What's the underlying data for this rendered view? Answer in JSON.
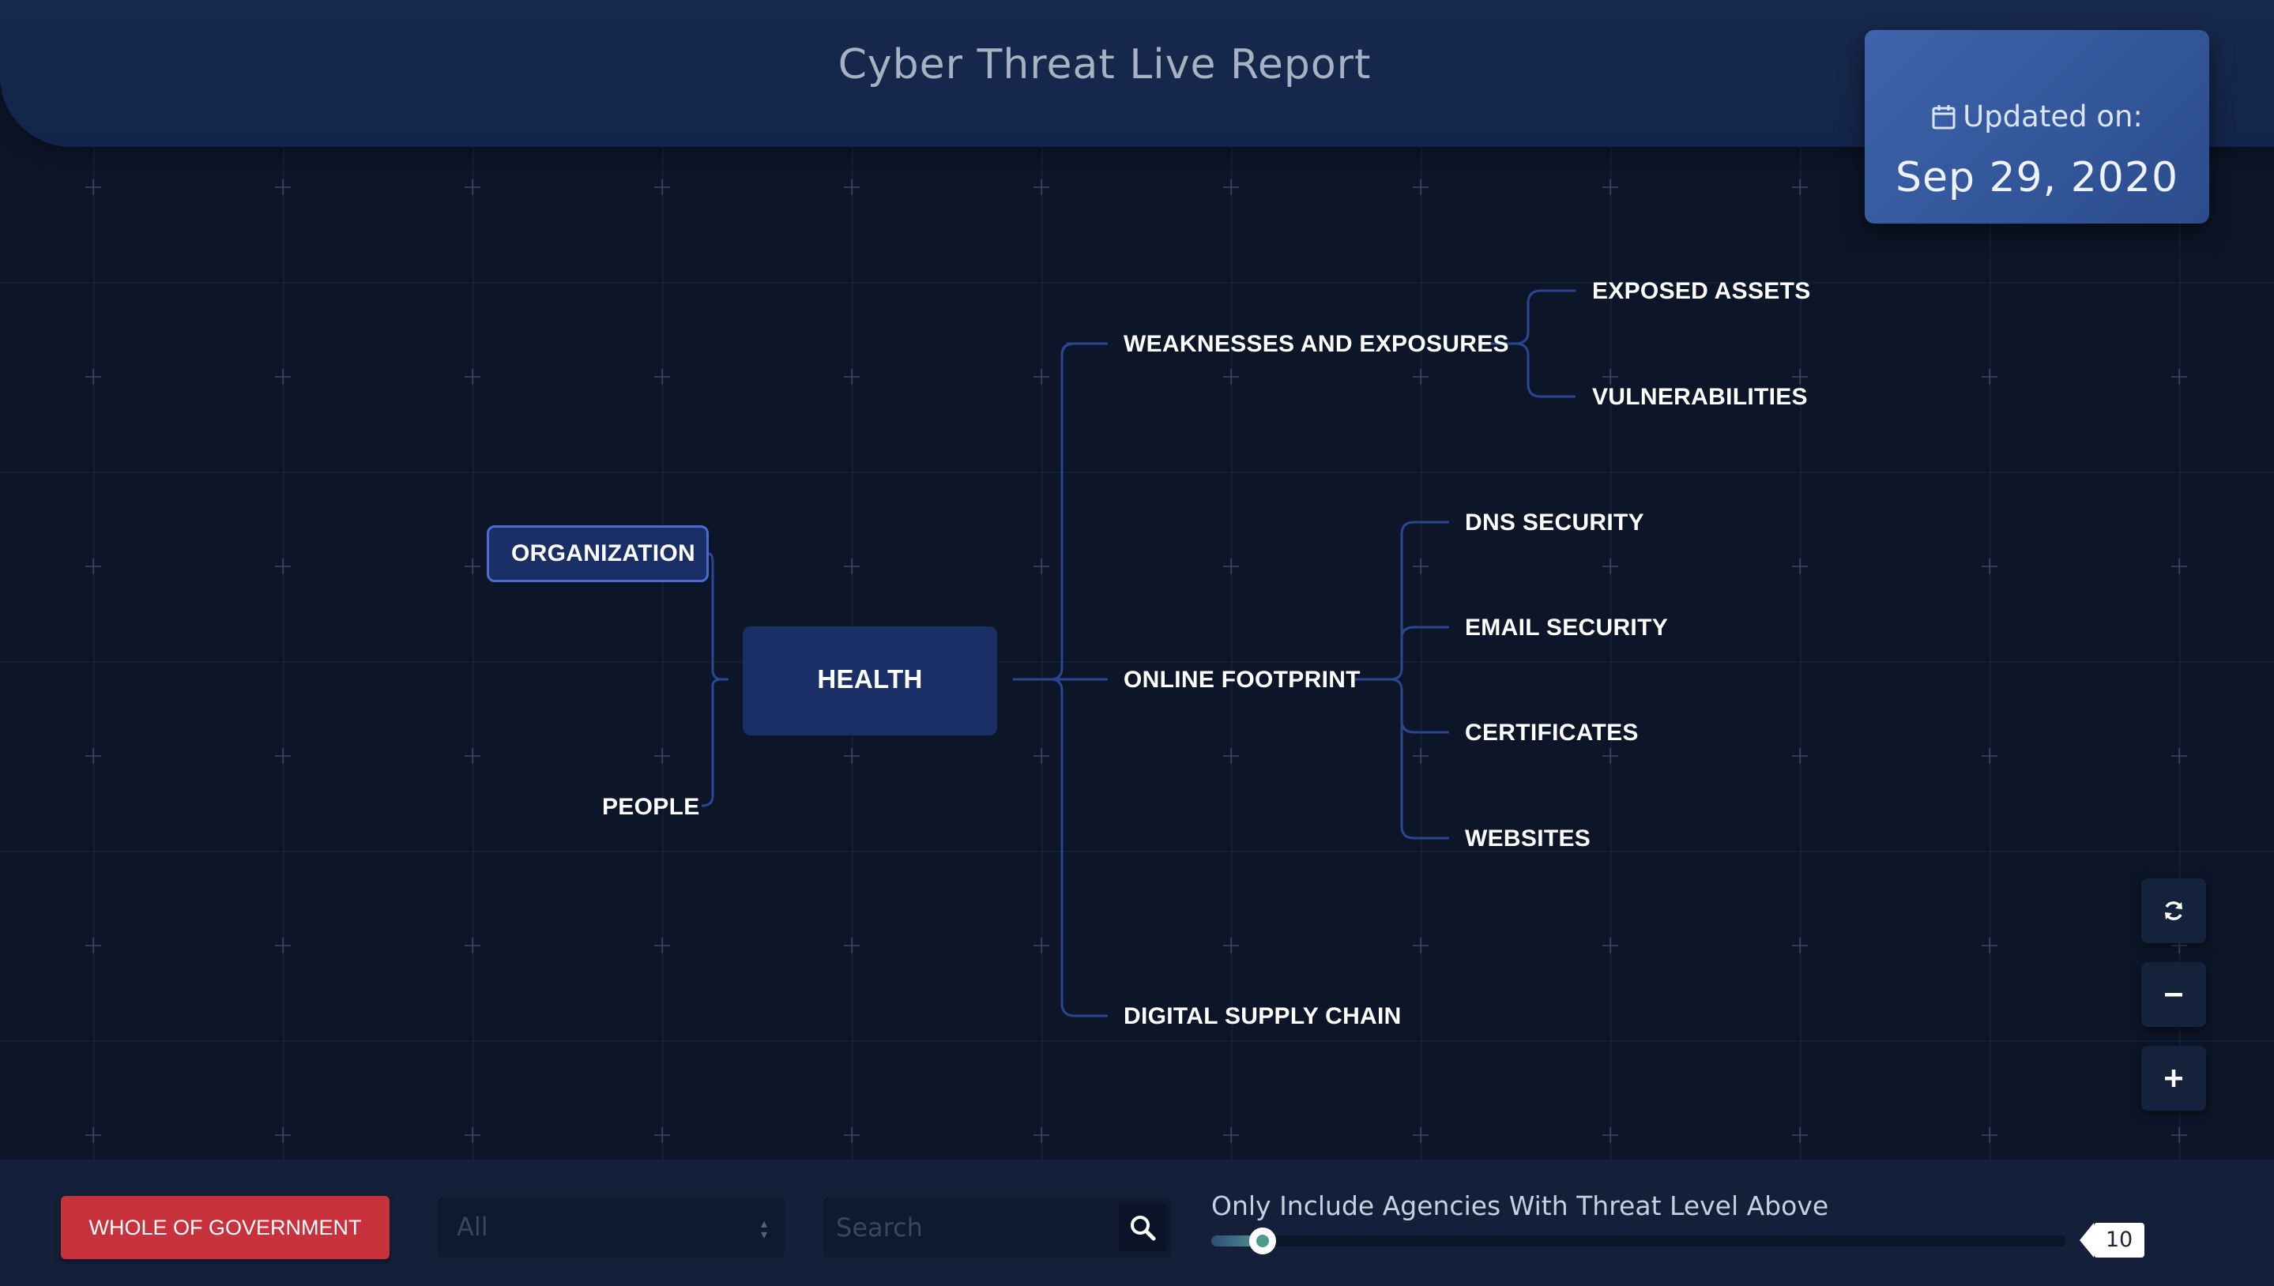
{
  "header": {
    "title": "Cyber Threat Live Report",
    "updated_label": "Updated on:",
    "updated_date": "Sep 29, 2020"
  },
  "tree": {
    "root": "HEALTH",
    "left": [
      "ORGANIZATION",
      "PEOPLE"
    ],
    "right": [
      {
        "label": "WEAKNESSES AND EXPOSURES",
        "children": [
          "EXPOSED ASSETS",
          "VULNERABILITIES"
        ]
      },
      {
        "label": "ONLINE FOOTPRINT",
        "children": [
          "DNS SECURITY",
          "EMAIL SECURITY",
          "CERTIFICATES",
          "WEBSITES"
        ]
      },
      {
        "label": "DIGITAL SUPPLY CHAIN",
        "children": []
      }
    ]
  },
  "controls": {
    "refresh_icon": "refresh-icon",
    "zoom_out_icon": "minus-icon",
    "zoom_in_icon": "plus-icon"
  },
  "footer": {
    "scope_button": "WHOLE OF GOVERNMENT",
    "filter_select": {
      "value": "All"
    },
    "search": {
      "placeholder": "Search",
      "icon": "search-icon"
    },
    "threshold_label": "Only Include Agencies With Threat Level Above",
    "threshold_value": "10",
    "threshold_fraction": 0.06
  },
  "colors": {
    "background": "#0c1628",
    "header": "#172a4d",
    "card": "#3e64ad",
    "node": "#1a2f66",
    "connector": "#2a4690",
    "button_red": "#c7323d",
    "slider_accent": "#4f9a8a"
  }
}
